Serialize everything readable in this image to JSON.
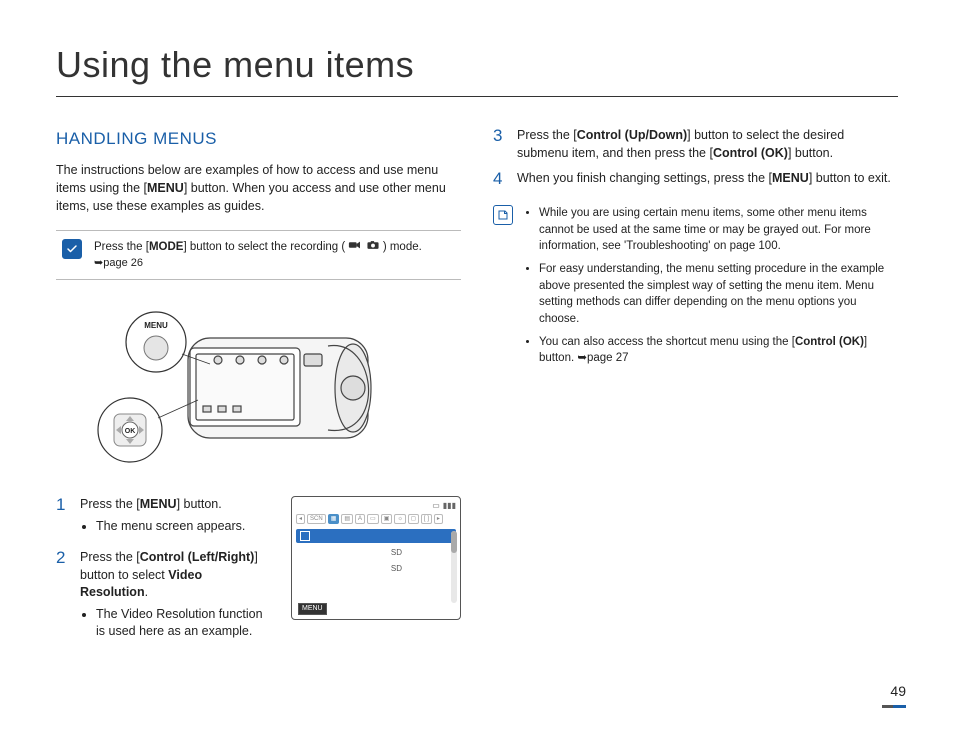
{
  "page_title": "Using the menu items",
  "section_title": "HANDLING MENUS",
  "intro_before": "The instructions below are examples of how to access and use menu items using the [",
  "intro_menu": "MENU",
  "intro_after": "] button. When you access and use other menu items, use these examples as guides.",
  "tip": {
    "before": "Press the [",
    "mode": "MODE",
    "after": "] button to select the recording (",
    "close": ") mode.",
    "page_ref": "➥page 26"
  },
  "illus": {
    "menu_label": "MENU",
    "ok_label": "OK"
  },
  "steps": {
    "s1": {
      "num": "1",
      "before": "Press the [",
      "bold": "MENU",
      "after": "] button.",
      "bullet1": "The menu screen appears."
    },
    "s2": {
      "num": "2",
      "before": "Press the [",
      "bold": "Control (Left/Right)",
      "mid": "] button to select ",
      "bold2": "Video Resolution",
      "after": ".",
      "bullet1": "The Video Resolution function is used here as an example."
    },
    "s3": {
      "num": "3",
      "before": "Press the [",
      "bold": "Control (Up/Down)",
      "mid": "] button to select the desired submenu item, and then press the [",
      "bold2": "Control (OK)",
      "after": "] button."
    },
    "s4": {
      "num": "4",
      "before": "When you finish changing settings, press the [",
      "bold": "MENU",
      "after": "] button to exit."
    }
  },
  "screen": {
    "menu_label": "MENU",
    "row_sd": "SD"
  },
  "notes": {
    "n1": "While you are using certain menu items, some other menu items cannot be used at the same time or may be grayed out. For more information, see 'Troubleshooting' on page 100.",
    "n2": "For easy understanding, the menu setting procedure in the example above presented the simplest way of setting the menu item. Menu setting methods can differ depending on the menu options you choose.",
    "n3_before": "You can also access the shortcut menu using the [",
    "n3_bold": "Control (OK)",
    "n3_after": "] button. ➥page 27"
  },
  "page_number": "49"
}
